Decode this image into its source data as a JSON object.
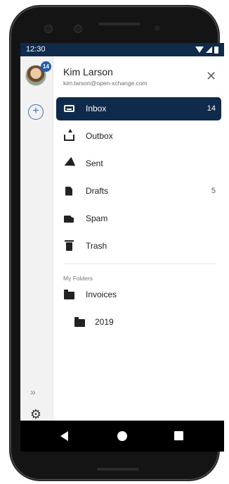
{
  "status_bar": {
    "time": "12:30"
  },
  "account": {
    "name": "Kim Larson",
    "email": "kim.larson@open-xchange.com",
    "unread_badge": "14",
    "avatar_icon": "user-avatar"
  },
  "rail": {
    "compose_icon": "plus-icon",
    "expand_icon": "double-chevron-right-icon",
    "settings_icon": "gear-icon"
  },
  "folders": [
    {
      "label": "Inbox",
      "count": "14",
      "icon": "inbox-icon",
      "active": true
    },
    {
      "label": "Outbox",
      "count": "",
      "icon": "outbox-icon"
    },
    {
      "label": "Sent",
      "count": "",
      "icon": "send-icon"
    },
    {
      "label": "Drafts",
      "count": "5",
      "icon": "draft-icon"
    },
    {
      "label": "Spam",
      "count": "",
      "icon": "spam-icon"
    },
    {
      "label": "Trash",
      "count": "",
      "icon": "trash-icon"
    }
  ],
  "my_folders": {
    "heading": "My Folders",
    "items": [
      {
        "label": "Invoices",
        "icon": "folder-icon"
      },
      {
        "label": "2019",
        "icon": "folder-icon"
      }
    ]
  },
  "colors": {
    "header_navy": "#0f2a4a",
    "accent_blue": "#1f5fb0"
  }
}
